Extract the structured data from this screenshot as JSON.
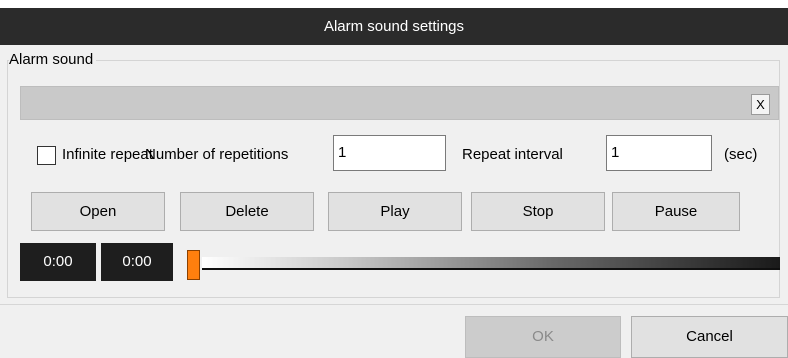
{
  "window": {
    "title": "Alarm sound settings"
  },
  "alarm_group": {
    "legend": "Alarm sound",
    "file_path": "",
    "clear_button": "X"
  },
  "options": {
    "infinite_repeat_label": "Infinite repeat",
    "infinite_repeat_checked": false,
    "repetitions_label": "Number of repetitions",
    "repetitions_value": "1",
    "interval_label": "Repeat interval",
    "interval_value": "1",
    "interval_unit": "(sec)"
  },
  "buttons": {
    "open": "Open",
    "delete": "Delete",
    "play": "Play",
    "stop": "Stop",
    "pause": "Pause"
  },
  "player": {
    "current_time": "0:00",
    "total_time": "0:00",
    "position": 0
  },
  "footer": {
    "ok": "OK",
    "ok_enabled": false,
    "cancel": "Cancel"
  },
  "colors": {
    "titlebar": "#2b2b2b",
    "handle": "#ff7f0e"
  }
}
